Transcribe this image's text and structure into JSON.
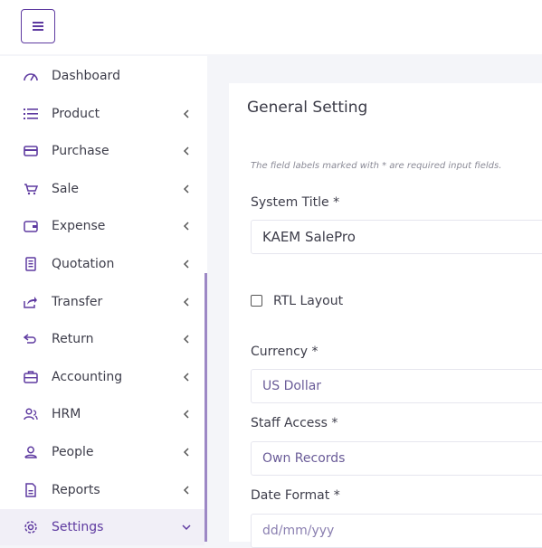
{
  "colors": {
    "accent": "#5e3aa0"
  },
  "header": {
    "menu_icon": "hamburger-icon"
  },
  "sidebar": {
    "items": [
      {
        "label": "Dashboard",
        "icon": "speedometer-icon",
        "has_chevron": false
      },
      {
        "label": "Product",
        "icon": "list-icon",
        "has_chevron": true
      },
      {
        "label": "Purchase",
        "icon": "card-icon",
        "has_chevron": true
      },
      {
        "label": "Sale",
        "icon": "cart-icon",
        "has_chevron": true
      },
      {
        "label": "Expense",
        "icon": "wallet-icon",
        "has_chevron": true
      },
      {
        "label": "Quotation",
        "icon": "document-icon",
        "has_chevron": true
      },
      {
        "label": "Transfer",
        "icon": "share-icon",
        "has_chevron": true
      },
      {
        "label": "Return",
        "icon": "return-icon",
        "has_chevron": true
      },
      {
        "label": "Accounting",
        "icon": "briefcase-icon",
        "has_chevron": true
      },
      {
        "label": "HRM",
        "icon": "users-icon",
        "has_chevron": true
      },
      {
        "label": "People",
        "icon": "user-icon",
        "has_chevron": true
      },
      {
        "label": "Reports",
        "icon": "report-icon",
        "has_chevron": true
      },
      {
        "label": "Settings",
        "icon": "gear-icon",
        "has_chevron": true,
        "active": true
      }
    ]
  },
  "main": {
    "title": "General Setting",
    "note": "The field labels marked with * are required input fields.",
    "system_title": {
      "label": "System Title *",
      "value": "KAEM SalePro"
    },
    "rtl": {
      "label": "RTL Layout",
      "checked": false
    },
    "currency": {
      "label": "Currency *",
      "value": "US Dollar"
    },
    "staff_access": {
      "label": "Staff Access *",
      "value": "Own Records"
    },
    "date_format": {
      "label": "Date Format *",
      "value": "dd/mm/yyy"
    }
  }
}
